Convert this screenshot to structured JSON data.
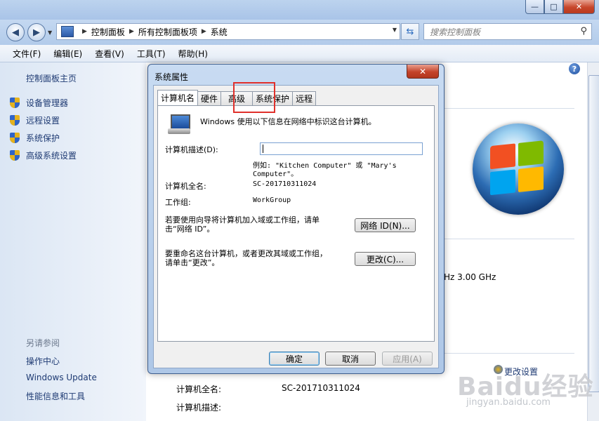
{
  "window": {
    "controls": {
      "minimize": "—",
      "maximize": "□",
      "close": "✕"
    }
  },
  "address": {
    "crumbs": [
      "控制面板",
      "所有控制面板项",
      "系统"
    ],
    "search_placeholder": "搜索控制面板"
  },
  "menu": [
    "文件(F)",
    "编辑(E)",
    "查看(V)",
    "工具(T)",
    "帮助(H)"
  ],
  "sidebar": {
    "home": "控制面板主页",
    "items": [
      "设备管理器",
      "远程设置",
      "系统保护",
      "高级系统设置"
    ],
    "see_also": "另请参阅",
    "links": [
      "操作中心",
      "Windows Update",
      "性能信息和工具"
    ]
  },
  "main": {
    "cpu_fragment": "Hz   3.00 GHz",
    "rows": [
      {
        "label": "计算机全名:",
        "value": "SC-201710311024"
      },
      {
        "label": "计算机描述:",
        "value": ""
      }
    ],
    "change_settings": "更改设置"
  },
  "watermark": {
    "main": "Baidu经验",
    "sub": "jingyan.baidu.com"
  },
  "dialog": {
    "title": "系统属性",
    "close": "✕",
    "tabs": [
      "计算机名",
      "硬件",
      "高级",
      "系统保护",
      "远程"
    ],
    "intro": "Windows 使用以下信息在网络中标识这台计算机。",
    "desc_label": "计算机描述(D):",
    "desc_value": "",
    "example_line1": "例如: \"Kitchen Computer\" 或 \"Mary's",
    "example_line2": "Computer\"。",
    "fullname_label": "计算机全名:",
    "fullname_value": "SC-201710311024",
    "workgroup_label": "工作组:",
    "workgroup_value": "WorkGroup",
    "netid_text1": "若要使用向导将计算机加入域或工作组，请单",
    "netid_text2": "击“网络 ID”。",
    "netid_button": "网络 ID(N)...",
    "rename_text1": "要重命名这台计算机，或者更改其域或工作组，",
    "rename_text2": "请单击“更改”。",
    "change_button": "更改(C)...",
    "ok": "确定",
    "cancel": "取消",
    "apply": "应用(A)"
  }
}
